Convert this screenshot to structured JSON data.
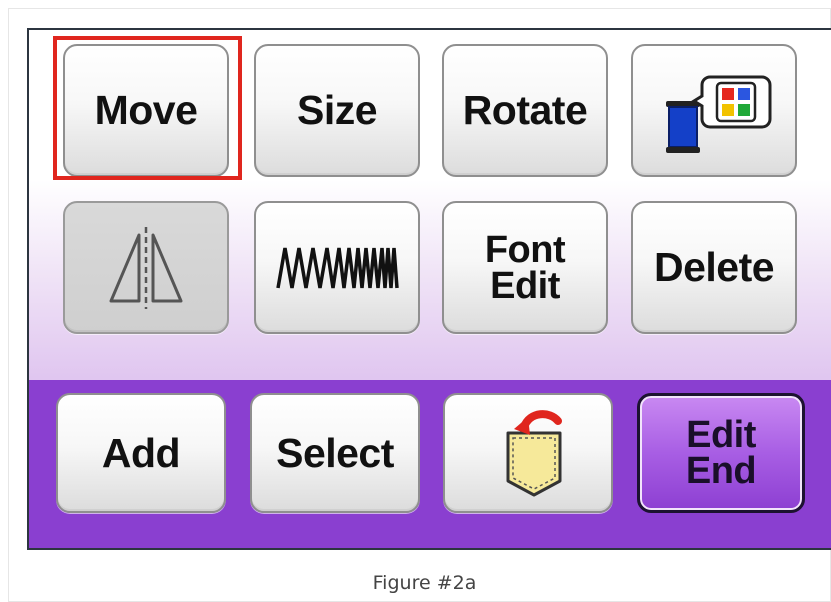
{
  "buttons": {
    "move": "Move",
    "size": "Size",
    "rotate": "Rotate",
    "thread_color": "thread-spool-color-palette-icon",
    "mirror": "mirror-flip-icon",
    "density": "zigzag-stitch-density-icon",
    "font_edit": "Font\nEdit",
    "delete": "Delete",
    "add": "Add",
    "select": "Select",
    "pocket": "pocket-memory-icon",
    "edit_end": "Edit\nEnd"
  },
  "caption": "Figure #2a",
  "colors": {
    "highlight": "#e0261e",
    "panel_bottom": "#8a3fd0",
    "edit_end": "#a85ee4"
  }
}
